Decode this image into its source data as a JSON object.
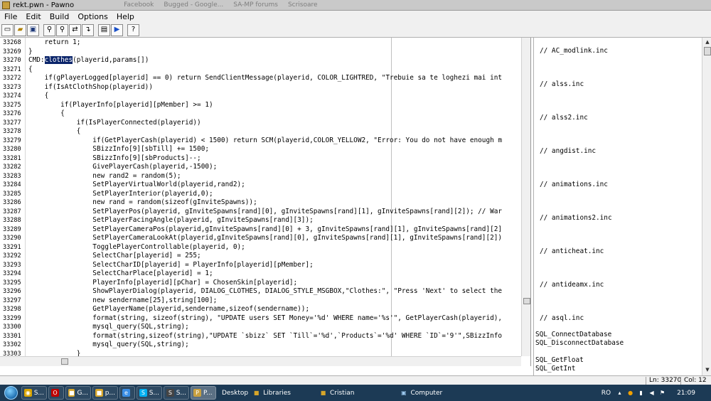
{
  "window": {
    "title": "rekt.pwn - Pawno",
    "ghost_tabs": [
      "Facebook",
      "Bugged - Google...",
      "SA-MP forums",
      "Scrisoare"
    ]
  },
  "menu": [
    "File",
    "Edit",
    "Build",
    "Options",
    "Help"
  ],
  "toolbar": {
    "icons": [
      "new-file-icon",
      "open-file-icon",
      "save-file-icon",
      "find-icon",
      "find-next-icon",
      "replace-icon",
      "goto-icon",
      "compile-icon",
      "run-icon",
      "help-icon"
    ]
  },
  "editor": {
    "lines": [
      {
        "n": "33268",
        "t": "    return 1;"
      },
      {
        "n": "33269",
        "t": "}"
      },
      {
        "n": "33270",
        "t": "CMD:",
        "sel": "clothes",
        "rest": "(playerid,params[])"
      },
      {
        "n": "33271",
        "t": "{"
      },
      {
        "n": "33272",
        "t": "    if(gPlayerLogged[playerid] == 0) return SendClientMessage(playerid, COLOR_LIGHTRED, \"Trebuie sa te loghezi mai int"
      },
      {
        "n": "33273",
        "t": "    if(IsAtClothShop(playerid))"
      },
      {
        "n": "33274",
        "t": "    {"
      },
      {
        "n": "33275",
        "t": "        if(PlayerInfo[playerid][pMember] >= 1)"
      },
      {
        "n": "33276",
        "t": "        {"
      },
      {
        "n": "33277",
        "t": "            if(IsPlayerConnected(playerid))"
      },
      {
        "n": "33278",
        "t": "            {"
      },
      {
        "n": "33279",
        "t": "                if(GetPlayerCash(playerid) < 1500) return SCM(playerid,COLOR_YELLOW2, \"Error: You do not have enough m"
      },
      {
        "n": "33280",
        "t": "                SBizzInfo[9][sbTill] += 1500;"
      },
      {
        "n": "33281",
        "t": "                SBizzInfo[9][sbProducts]--;"
      },
      {
        "n": "33282",
        "t": "                GivePlayerCash(playerid,-1500);"
      },
      {
        "n": "33283",
        "t": "                new rand2 = random(5);"
      },
      {
        "n": "33284",
        "t": "                SetPlayerVirtualWorld(playerid,rand2);"
      },
      {
        "n": "33285",
        "t": "                SetPlayerInterior(playerid,0);"
      },
      {
        "n": "33286",
        "t": "                new rand = random(sizeof(gInviteSpawns));"
      },
      {
        "n": "33287",
        "t": "                SetPlayerPos(playerid, gInviteSpawns[rand][0], gInviteSpawns[rand][1], gInviteSpawns[rand][2]); // War"
      },
      {
        "n": "33288",
        "t": "                SetPlayerFacingAngle(playerid, gInviteSpawns[rand][3]);"
      },
      {
        "n": "33289",
        "t": "                SetPlayerCameraPos(playerid,gInviteSpawns[rand][0] + 3, gInviteSpawns[rand][1], gInviteSpawns[rand][2]"
      },
      {
        "n": "33290",
        "t": "                SetPlayerCameraLookAt(playerid,gInviteSpawns[rand][0], gInviteSpawns[rand][1], gInviteSpawns[rand][2])"
      },
      {
        "n": "33291",
        "t": "                TogglePlayerControllable(playerid, 0);"
      },
      {
        "n": "33292",
        "t": "                SelectChar[playerid] = 255;"
      },
      {
        "n": "33293",
        "t": "                SelectCharID[playerid] = PlayerInfo[playerid][pMember];"
      },
      {
        "n": "33294",
        "t": "                SelectCharPlace[playerid] = 1;"
      },
      {
        "n": "33295",
        "t": "                PlayerInfo[playerid][pChar] = ChosenSkin[playerid];"
      },
      {
        "n": "33296",
        "t": "                ShowPlayerDialog(playerid, DIALOG_CLOTHES, DIALOG_STYLE_MSGBOX,\"Clothes:\", \"Press 'Next' to select the"
      },
      {
        "n": "33297",
        "t": "                new sendername[25],string[100];"
      },
      {
        "n": "33298",
        "t": "                GetPlayerName(playerid,sendername,sizeof(sendername));"
      },
      {
        "n": "33299",
        "t": "                format(string, sizeof(string), \"UPDATE users SET Money='%d' WHERE name='%s'\", GetPlayerCash(playerid),"
      },
      {
        "n": "33300",
        "t": "                mysql_query(SQL,string);"
      },
      {
        "n": "33301",
        "t": "                format(string,sizeof(string),\"UPDATE `sbizz` SET `Till`='%d',`Products`='%d' WHERE `ID`='9'\",SBizzInfo"
      },
      {
        "n": "33302",
        "t": "                mysql_query(SQL,string);"
      },
      {
        "n": "33303",
        "t": "            }"
      },
      {
        "n": "33304",
        "t": "        }"
      }
    ]
  },
  "panel": {
    "items": [
      "// AC_modlink.inc",
      "// alss.inc",
      "// alss2.inc",
      "// angdist.inc",
      "// animations.inc",
      "// animations2.inc",
      "// anticheat.inc",
      "// antideamx.inc",
      "// asql.inc",
      "SQL_ConnectDatabase",
      "SQL_DisconnectDatabase",
      "",
      "SQL_GetFloat",
      "SQL_GetInt"
    ]
  },
  "status": {
    "position": "Ln: 33270",
    "column": "Col: 12"
  },
  "taskbar": {
    "buttons": [
      {
        "label": "S...",
        "icon": "chrome-icon",
        "color": "#d9a400"
      },
      {
        "label": "",
        "icon": "opera-icon",
        "color": "#c00000"
      },
      {
        "label": "G...",
        "icon": "folder-icon",
        "color": "#d6a52a"
      },
      {
        "label": "p...",
        "icon": "folder-icon",
        "color": "#d6a52a"
      },
      {
        "label": "",
        "icon": "ie-icon",
        "color": "#3a8ee6"
      },
      {
        "label": "S...",
        "icon": "skype-icon",
        "color": "#00aff0"
      },
      {
        "label": "S...",
        "icon": "samp-icon",
        "color": "#444444"
      },
      {
        "label": "P...",
        "icon": "pawno-icon",
        "color": "#c8a040"
      }
    ],
    "links": [
      "Desktop",
      "Libraries",
      "Cristian",
      "Computer"
    ],
    "tray": {
      "lang": "RO",
      "time": "21:09"
    }
  }
}
